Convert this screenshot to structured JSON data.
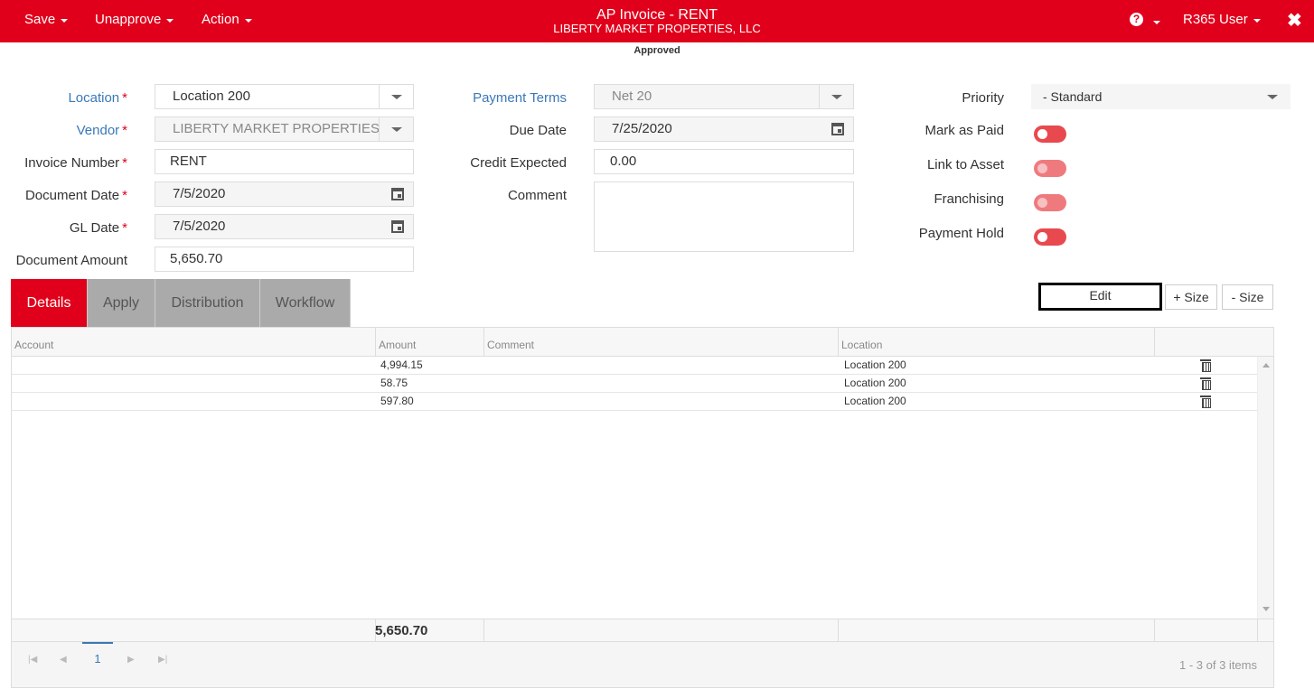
{
  "topbar": {
    "menus": [
      {
        "label": "Save"
      },
      {
        "label": "Unapprove"
      },
      {
        "label": "Action"
      }
    ],
    "title": "AP Invoice - RENT",
    "subtitle": "LIBERTY MARKET PROPERTIES, LLC",
    "help_icon_text": "?",
    "user": "R365 User",
    "close_glyph": "✖",
    "accent_color": "#e0001b"
  },
  "status": "Approved",
  "form": {
    "location": {
      "label": "Location",
      "value": "Location 200"
    },
    "vendor": {
      "label": "Vendor",
      "value": "LIBERTY MARKET PROPERTIES, LLC"
    },
    "invoice_number": {
      "label": "Invoice Number",
      "value": "RENT"
    },
    "document_date": {
      "label": "Document Date",
      "value": "7/5/2020"
    },
    "gl_date": {
      "label": "GL Date",
      "value": "7/5/2020"
    },
    "document_amount": {
      "label": "Document Amount",
      "value": "5,650.70"
    },
    "payment_terms": {
      "label": "Payment Terms",
      "value": "Net 20"
    },
    "due_date": {
      "label": "Due Date",
      "value": "7/25/2020"
    },
    "credit_expected": {
      "label": "Credit Expected",
      "value": "0.00"
    },
    "comment": {
      "label": "Comment",
      "value": ""
    },
    "priority": {
      "label": "Priority",
      "value": "-  Standard"
    },
    "mark_as_paid": {
      "label": "Mark as Paid"
    },
    "link_to_asset": {
      "label": "Link to Asset"
    },
    "franchising": {
      "label": "Franchising"
    },
    "payment_hold": {
      "label": "Payment Hold"
    },
    "required_marker": "*"
  },
  "tabs": [
    {
      "label": "Details",
      "active": true
    },
    {
      "label": "Apply"
    },
    {
      "label": "Distribution"
    },
    {
      "label": "Workflow"
    }
  ],
  "actions": {
    "edit": "Edit",
    "size_up": "+ Size",
    "size_down": "- Size"
  },
  "grid": {
    "columns": [
      "Account",
      "Amount",
      "Comment",
      "Location"
    ],
    "rows": [
      {
        "account": "",
        "amount": "4,994.15",
        "comment": "",
        "location": "Location 200"
      },
      {
        "account": "",
        "amount": "58.75",
        "comment": "",
        "location": "Location 200"
      },
      {
        "account": "",
        "amount": "597.80",
        "comment": "",
        "location": "Location 200"
      }
    ],
    "total_amount": "5,650.70",
    "pager": {
      "current_page": "1",
      "info": "1 - 3 of 3 items"
    }
  }
}
